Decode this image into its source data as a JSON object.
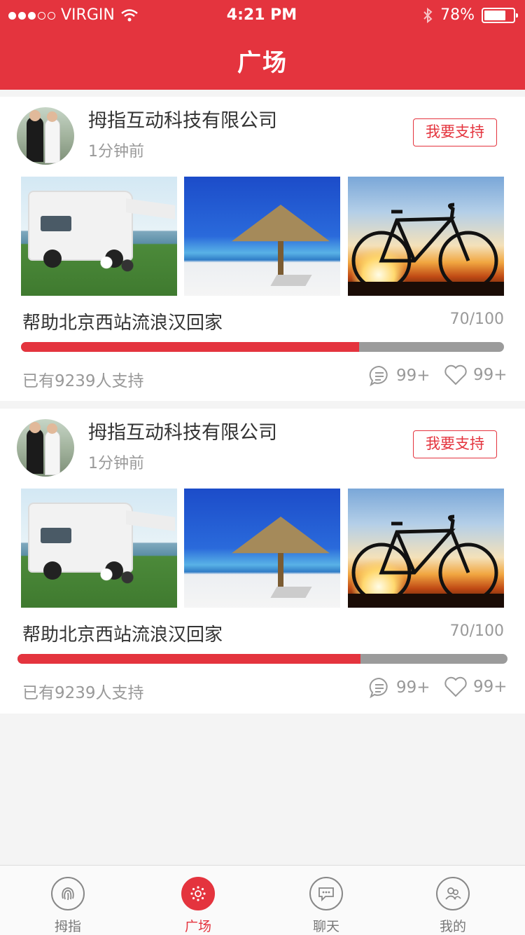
{
  "status_bar": {
    "carrier": "VIRGIN",
    "time": "4:21 PM",
    "battery": "78%"
  },
  "header": {
    "title": "广场"
  },
  "posts": [
    {
      "company": "拇指互动科技有限公司",
      "time_ago": "1分钟前",
      "support_button": "我要支持",
      "cause": "帮助北京西站流浪汉回家",
      "progress_text": "70/100",
      "progress_fraction": 0.7,
      "supporters": "已有9239人支持",
      "comments": "99+",
      "likes": "99+"
    },
    {
      "company": "拇指互动科技有限公司",
      "time_ago": "1分钟前",
      "support_button": "我要支持",
      "cause": "帮助北京西站流浪汉回家",
      "progress_text": "70/100",
      "progress_fraction": 0.7,
      "supporters": "已有9239人支持",
      "comments": "99+",
      "likes": "99+"
    }
  ],
  "tabbar": {
    "items": [
      {
        "label": "拇指",
        "icon": "fingerprint-icon"
      },
      {
        "label": "广场",
        "icon": "plaza-icon"
      },
      {
        "label": "聊天",
        "icon": "chat-icon"
      },
      {
        "label": "我的",
        "icon": "users-icon"
      }
    ],
    "active": "广场"
  },
  "colors": {
    "brand": "#e4343e",
    "muted": "#999999",
    "bar_track": "#9b9b9b"
  }
}
